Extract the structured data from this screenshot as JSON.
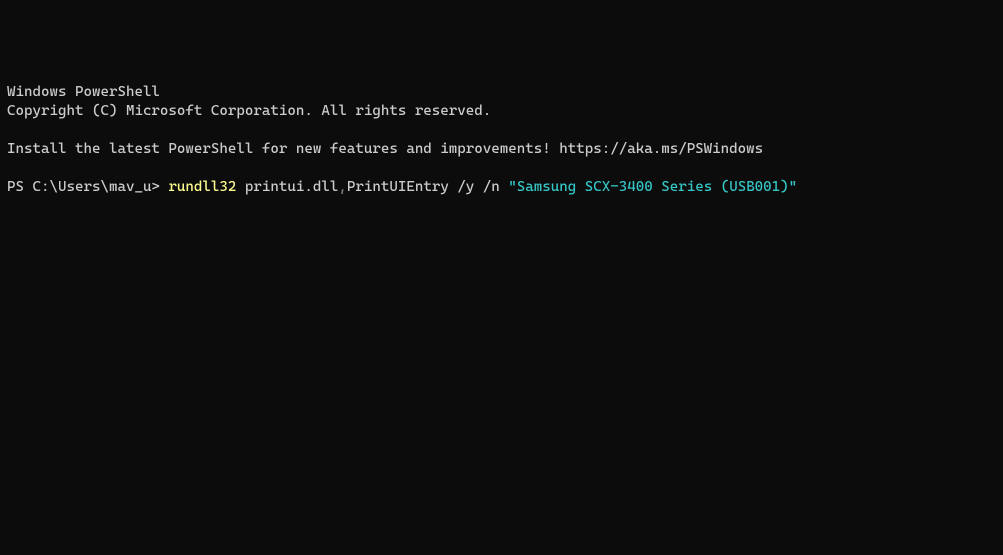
{
  "header": {
    "line1": "Windows PowerShell",
    "line2": "Copyright (C) Microsoft Corporation. All rights reserved."
  },
  "install_msg": "Install the latest PowerShell for new features and improvements! https://aka.ms/PSWindows",
  "prompt": {
    "ps_prefix": "PS C:\\Users\\mav_u> ",
    "cmd_exe": "rundll32",
    "cmd_args1": " printui.dll",
    "cmd_comma": ",",
    "cmd_args2": "PrintUIEntry /y /n ",
    "cmd_string": "\"Samsung SCX-3400 Series (USB001)\""
  }
}
